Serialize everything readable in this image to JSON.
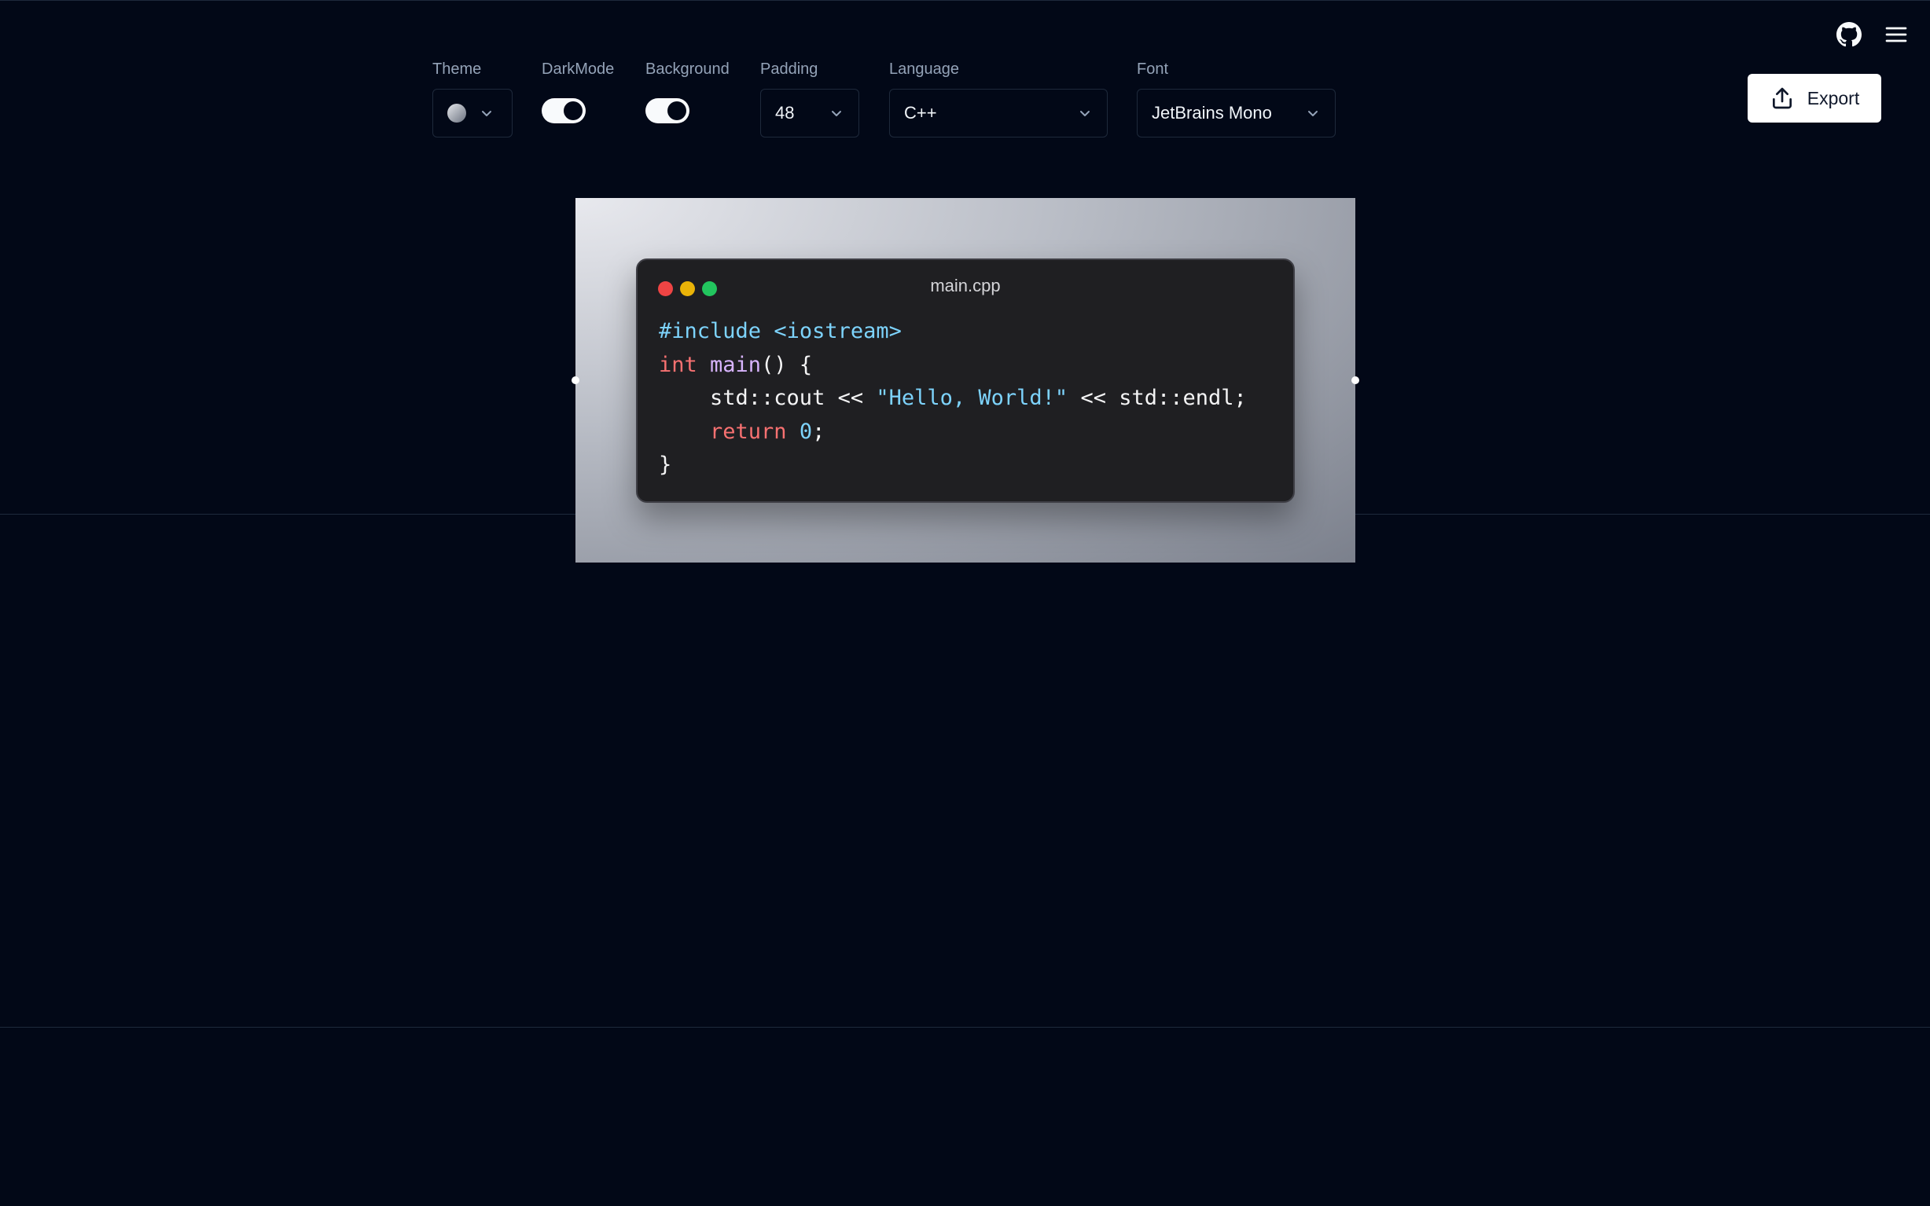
{
  "toolbar": {
    "theme": {
      "label": "Theme"
    },
    "dark_mode": {
      "label": "DarkMode",
      "on": true
    },
    "background": {
      "label": "Background",
      "on": true
    },
    "padding": {
      "label": "Padding",
      "value": "48"
    },
    "language": {
      "label": "Language",
      "value": "C++"
    },
    "font": {
      "label": "Font",
      "value": "JetBrains Mono"
    }
  },
  "header": {
    "export_label": "Export",
    "icons": [
      "github-icon",
      "menu-icon",
      "export-icon",
      "chevron-down-icon"
    ]
  },
  "editor": {
    "filename": "main.cpp",
    "code_lines": [
      [
        {
          "t": "#include ",
          "c": "pre"
        },
        {
          "t": "<iostream>",
          "c": "str"
        }
      ],
      [
        {
          "t": "int ",
          "c": "kw"
        },
        {
          "t": "main",
          "c": "fn"
        },
        {
          "t": "() {",
          "c": "plain"
        }
      ],
      [
        {
          "t": "    std::cout << ",
          "c": "plain"
        },
        {
          "t": "\"Hello, World!\"",
          "c": "str"
        },
        {
          "t": " << std::endl;",
          "c": "plain"
        }
      ],
      [
        {
          "t": "    ",
          "c": "plain"
        },
        {
          "t": "return ",
          "c": "kw"
        },
        {
          "t": "0",
          "c": "num"
        },
        {
          "t": ";",
          "c": "plain"
        }
      ],
      [
        {
          "t": "}",
          "c": "plain"
        }
      ]
    ]
  },
  "colors": {
    "page_bg": "#020817",
    "window_bg": "#1f1f22",
    "dot_red": "#ef4444",
    "dot_yellow": "#eab308",
    "dot_green": "#22c55e"
  }
}
